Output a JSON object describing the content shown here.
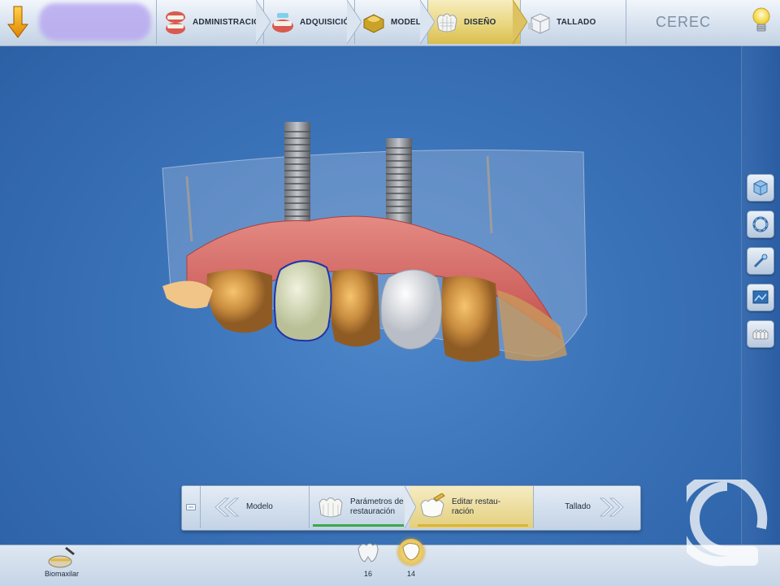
{
  "nav": {
    "steps": [
      {
        "label": "ADMINISTRACIÓN",
        "icon": "admin-jaw-icon",
        "active": false
      },
      {
        "label": "ADQUISICIÓN",
        "icon": "acquisition-jaw-icon",
        "active": false
      },
      {
        "label": "MODELO",
        "icon": "model-tooth-icon",
        "active": false
      },
      {
        "label": "DISEÑO",
        "icon": "design-crown-icon",
        "active": true
      },
      {
        "label": "TALLADO",
        "icon": "milling-block-icon",
        "active": false
      }
    ],
    "brand": "CEREC"
  },
  "colors": {
    "accent": "#e3cf7d",
    "active_gold": "#d8b43c",
    "progress_green": "#3aa94b",
    "viewport_blue": "#3a72b8"
  },
  "toolbar_right": {
    "tools": [
      {
        "icon": "view-cube-icon"
      },
      {
        "icon": "rotate-ring-icon"
      },
      {
        "icon": "tool-wand-icon"
      },
      {
        "icon": "screenshot-gallery-icon"
      },
      {
        "icon": "model-blocks-icon"
      }
    ]
  },
  "stepbar": {
    "prev_label": "Modelo",
    "step1_label_line1": "Parámetros de",
    "step1_label_line2": "restauración",
    "step2_label_line1": "Editar restau-",
    "step2_label_line2": "ración",
    "next_label": "Tallado"
  },
  "bottom": {
    "biomaxilar_label": "Biomaxilar",
    "teeth": [
      {
        "number": "16",
        "active": false
      },
      {
        "number": "14",
        "active": true
      }
    ]
  }
}
